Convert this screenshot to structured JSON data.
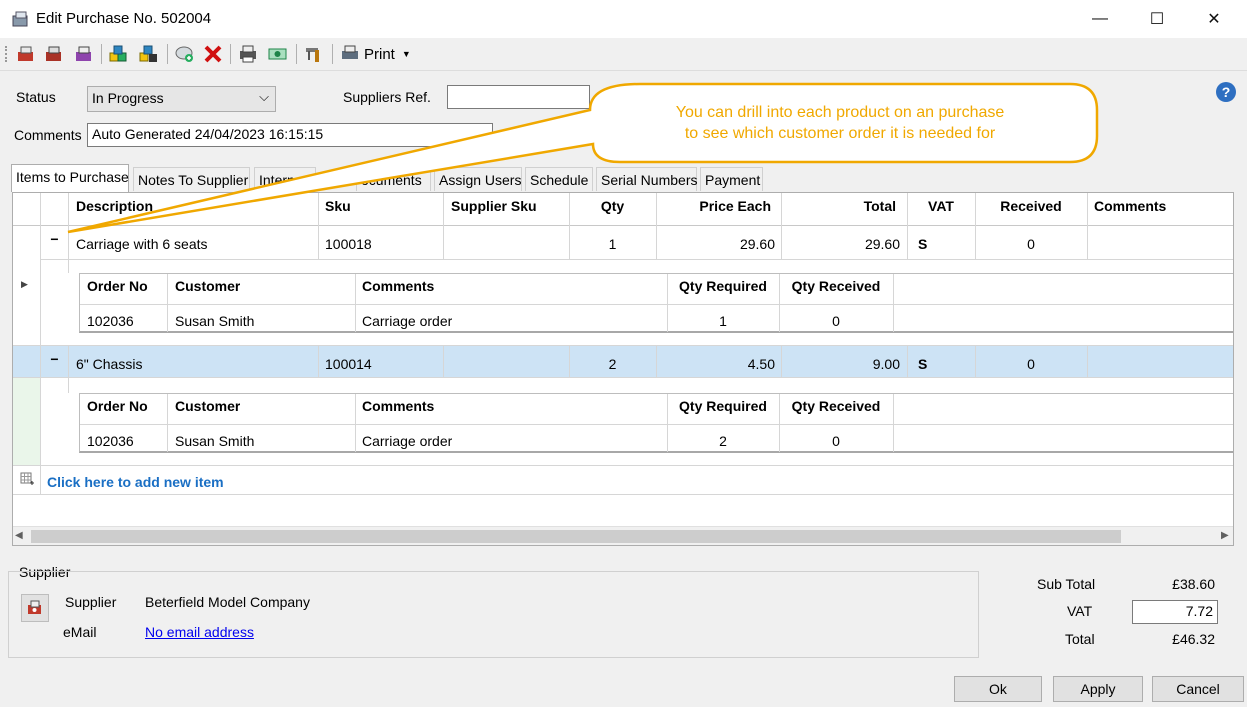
{
  "window": {
    "title": "Edit Purchase No. 502004",
    "minimize": "—",
    "maximize": "☐",
    "close": "✕"
  },
  "toolbar": {
    "print_label": "Print"
  },
  "form": {
    "status_label": "Status",
    "status_value": "In Progress",
    "suppliers_ref_label": "Suppliers Ref.",
    "suppliers_ref_value": "",
    "comments_label": "Comments",
    "comments_value": "Auto Generated 24/04/2023 16:15:15"
  },
  "callout": {
    "line1": "You can drill into each product on an purchase",
    "line2": "to see which customer order it is needed for"
  },
  "tabs": [
    {
      "label": "Items to Purchase"
    },
    {
      "label": "Notes To Supplier"
    },
    {
      "label": "Intern"
    },
    {
      "label": "ocuments"
    },
    {
      "label": "Assign Users"
    },
    {
      "label": "Schedule"
    },
    {
      "label": "Serial Numbers"
    },
    {
      "label": "Payment"
    }
  ],
  "grid": {
    "columns": [
      "Description",
      "Sku",
      "Supplier Sku",
      "Qty",
      "Price Each",
      "Total",
      "VAT",
      "Received",
      "Comments"
    ],
    "sub_columns": [
      "Order No",
      "Customer",
      "Comments",
      "Qty Required",
      "Qty Received"
    ],
    "rows": [
      {
        "expander": "−",
        "description": "Carriage with 6 seats",
        "sku": "100018",
        "supplier_sku": "",
        "qty": "1",
        "price_each": "29.60",
        "total": "29.60",
        "vat": "S",
        "received": "0",
        "comments": "",
        "orders": [
          {
            "order_no": "102036",
            "customer": "Susan Smith",
            "comments": "Carriage order",
            "qty_required": "1",
            "qty_received": "0"
          }
        ]
      },
      {
        "expander": "−",
        "description": "6\" Chassis",
        "sku": "100014",
        "supplier_sku": "",
        "qty": "2",
        "price_each": "4.50",
        "total": "9.00",
        "vat": "S",
        "received": "0",
        "comments": "",
        "orders": [
          {
            "order_no": "102036",
            "customer": "Susan Smith",
            "comments": "Carriage order",
            "qty_required": "2",
            "qty_received": "0"
          }
        ]
      }
    ],
    "add_item": "Click here to add new item"
  },
  "supplier": {
    "group_label": "Supplier",
    "supplier_label": "Supplier",
    "supplier_value": "Beterfield Model Company",
    "email_label": "eMail",
    "email_value": "No email address"
  },
  "totals": {
    "subtotal_label": "Sub Total",
    "subtotal_value": "£38.60",
    "vat_label": "VAT",
    "vat_value": "7.72",
    "total_label": "Total",
    "total_value": "£46.32"
  },
  "buttons": {
    "ok": "Ok",
    "apply": "Apply",
    "cancel": "Cancel"
  },
  "colors": {
    "accent": "#f0a800",
    "selected_row": "#cde3f5",
    "link": "#1a6fc4"
  }
}
